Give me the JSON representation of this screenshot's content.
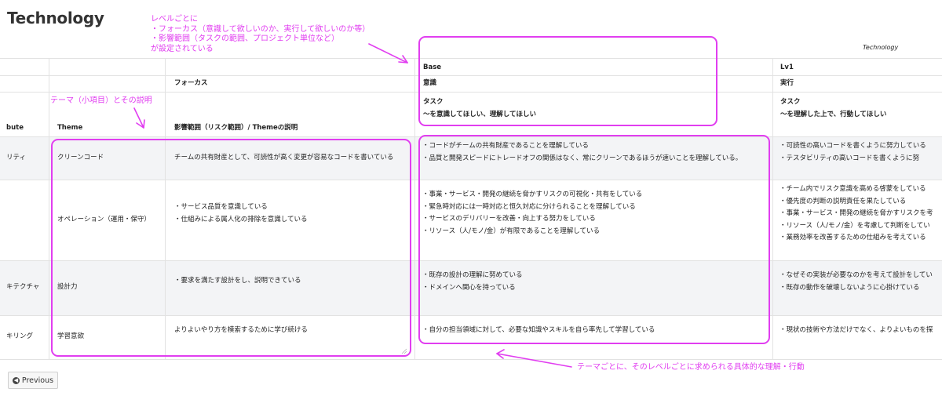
{
  "page": {
    "title": "Technology",
    "sheet_label": "Technology"
  },
  "table": {
    "header": {
      "level_base": "Base",
      "level_lv1": "Lv1",
      "focus_label": "フォーカス",
      "focus_base": "意識",
      "focus_lv1": "実行",
      "col_attribute": "bute",
      "col_theme": "Theme",
      "col_scope": "影響範囲（リスク範囲）/ Themeの説明",
      "scope_base": [
        "タスク",
        "〜を意識してほしい、理解してほしい"
      ],
      "scope_lv1": [
        "タスク",
        "〜を理解した上で、行動してほしい"
      ]
    },
    "rows": [
      {
        "attribute": "リティ",
        "theme": "クリーンコード",
        "description": [
          "チームの共有財産として、可読性が高く変更が容易なコードを書いている"
        ],
        "base": [
          "・コードがチームの共有財産であることを理解している",
          "・品質と開発スピードにトレードオフの関係はなく、常にクリーンであるほうが速いことを理解している。"
        ],
        "lv1": [
          "・可読性の高いコードを書くように努力している",
          "・テスタビリティの高いコードを書くように努"
        ]
      },
      {
        "attribute": "",
        "theme": "オペレーション（運用・保守）",
        "description": [
          "・サービス品質を意識している",
          "・仕組みによる属人化の排除を意識している"
        ],
        "base": [
          "・事業・サービス・開発の継続を脅かすリスクの可視化・共有をしている",
          "・緊急時対応には一時対応と恒久対応に分けられることを理解している",
          "・サービスのデリバリーを改善・向上する努力をしている",
          "・リソース（人/モノ/金）が有限であることを理解している"
        ],
        "lv1": [
          "・チーム内でリスク意識を高める啓蒙をしている",
          "・優先度の判断の説明責任を果たしている",
          "・事業・サービス・開発の継続を脅かすリスクを考",
          "・リソース（人/モノ/金）を考慮して判断をしてい",
          "・業務効率を改善するための仕組みを考えている"
        ]
      },
      {
        "attribute": "キテクチャ",
        "theme": "設計力",
        "description": [
          "・要求を満たす設計をし、説明できている"
        ],
        "base": [
          "・既存の設計の理解に努めている",
          "・ドメインへ関心を持っている"
        ],
        "lv1": [
          "・なぜその実装が必要なのかを考えて設計をしてい",
          "・既存の動作を破壊しないように心掛けている"
        ]
      },
      {
        "attribute": "キリング",
        "theme": "学習意欲",
        "description": [
          "よりよいやり方を模索するために学び続ける"
        ],
        "base": [
          "・自分の担当領域に対して、必要な知識やスキルを自ら率先して学習している"
        ],
        "lv1": [
          "・現状の技術や方法だけでなく、よりよいものを探"
        ]
      }
    ]
  },
  "annotations": {
    "level_note": [
      "レベルごとに",
      "・フォーカス（意識して欲しいのか、実行して欲しいのか等）",
      "・影響範囲（タスクの範囲、プロジェクト単位など）",
      "が設定されている"
    ],
    "theme_note": "テーマ（小項目）とその説明",
    "behavior_note": "テーマごとに、そのレベルごとに求められる具体的な理解・行動"
  },
  "navigation": {
    "previous_label": "Previous"
  },
  "colors": {
    "annotation": "#e13ef0",
    "row_shade": "#f3f4f6",
    "grid": "#e2e2e2"
  }
}
